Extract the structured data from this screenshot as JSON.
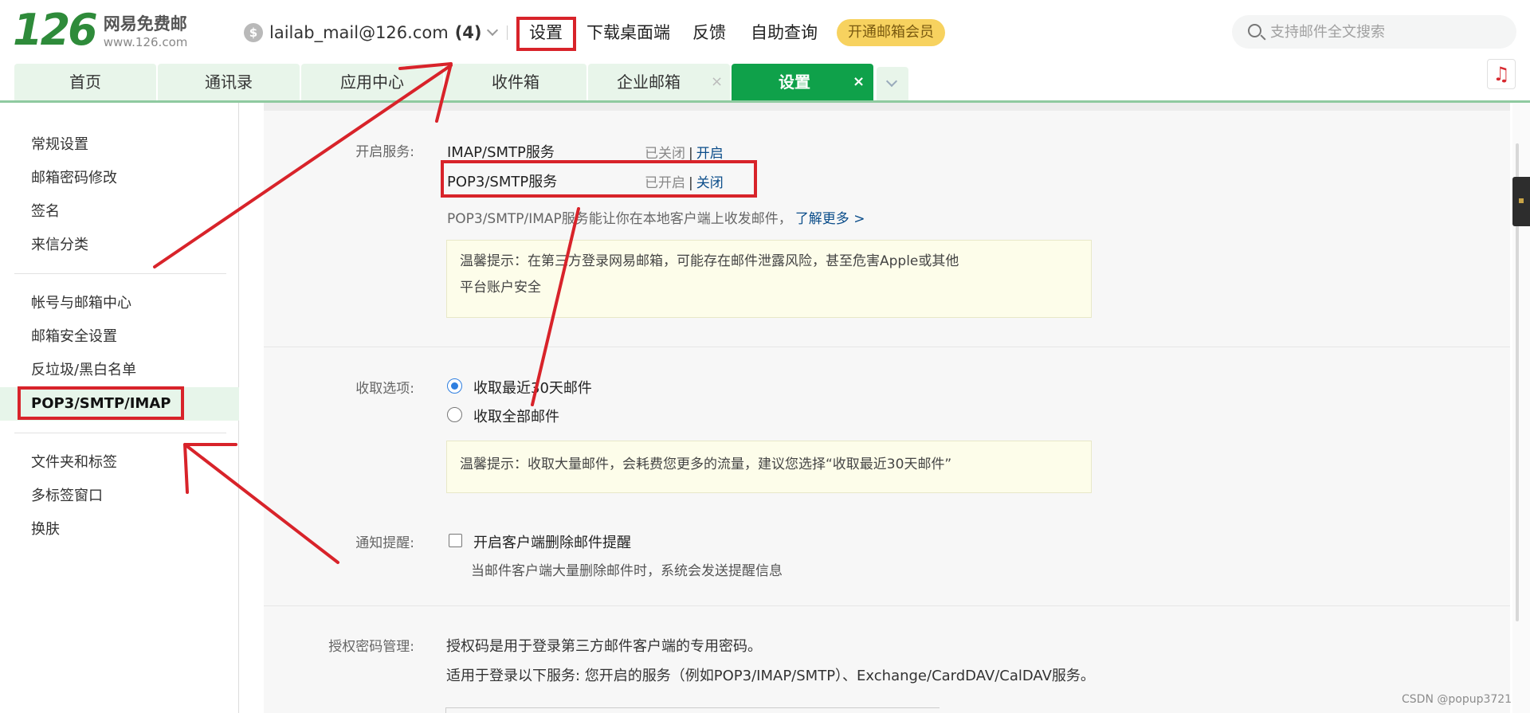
{
  "logo": {
    "number": "126",
    "cn": "网易免费邮",
    "url": "www.126.com"
  },
  "account": {
    "icon": "coin-icon",
    "email": "lailab_mail@126.com",
    "count": "(4)"
  },
  "topnav": {
    "settings": "设置",
    "download": "下载桌面端",
    "feedback": "反馈",
    "selfquery": "自助查询",
    "vip": "开通邮箱会员"
  },
  "search": {
    "placeholder": "支持邮件全文搜索"
  },
  "tabs": [
    {
      "label": "首页"
    },
    {
      "label": "通讯录"
    },
    {
      "label": "应用中心"
    },
    {
      "label": "收件箱"
    },
    {
      "label": "企业邮箱"
    },
    {
      "label": "设置",
      "active": true
    }
  ],
  "tab_close": "×",
  "music_icon": "♫",
  "sidebar": {
    "group1": [
      "常规设置",
      "邮箱密码修改",
      "签名",
      "来信分类"
    ],
    "group2": [
      "帐号与邮箱中心",
      "邮箱安全设置",
      "反垃圾/黑白名单",
      "POP3/SMTP/IMAP"
    ],
    "group3": [
      "文件夹和标签",
      "多标签窗口",
      "换肤"
    ],
    "active": "POP3/SMTP/IMAP"
  },
  "services": {
    "label": "开启服务:",
    "imap": {
      "name": "IMAP/SMTP服务",
      "state": "已关闭",
      "action": "开启"
    },
    "pop3": {
      "name": "POP3/SMTP服务",
      "state": "已开启",
      "action": "关闭"
    },
    "pipe": "|",
    "info": "POP3/SMTP/IMAP服务能让你在本地客户端上收发邮件，",
    "learn_more": "了解更多 >",
    "notice_line1": "温馨提示：在第三方登录网易邮箱，可能存在邮件泄露风险，甚至危害Apple或其他",
    "notice_line2": "平台账户安全"
  },
  "receive": {
    "label": "收取选项:",
    "option_recent": "收取最近30天邮件",
    "option_all": "收取全部邮件",
    "selected": "recent",
    "notice": "温馨提示：收取大量邮件，会耗费您更多的流量，建议您选择“收取最近30天邮件”"
  },
  "notify": {
    "label": "通知提醒:",
    "checkbox_label": "开启客户端删除邮件提醒",
    "checked": false,
    "hint": "当邮件客户端大量删除邮件时，系统会发送提醒信息"
  },
  "auth": {
    "label": "授权密码管理:",
    "line1": "授权码是用于登录第三方邮件客户端的专用密码。",
    "line2": "适用于登录以下服务: 您开启的服务（例如POP3/IMAP/SMTP）、Exchange/CardDAV/CalDAV服务。"
  },
  "watermark": "CSDN @popup3721",
  "colors": {
    "brand_green": "#0fa14a",
    "annotation_red": "#d8232a",
    "link_blue": "#0b4d8a",
    "vip_yellow": "#f7d25f"
  }
}
